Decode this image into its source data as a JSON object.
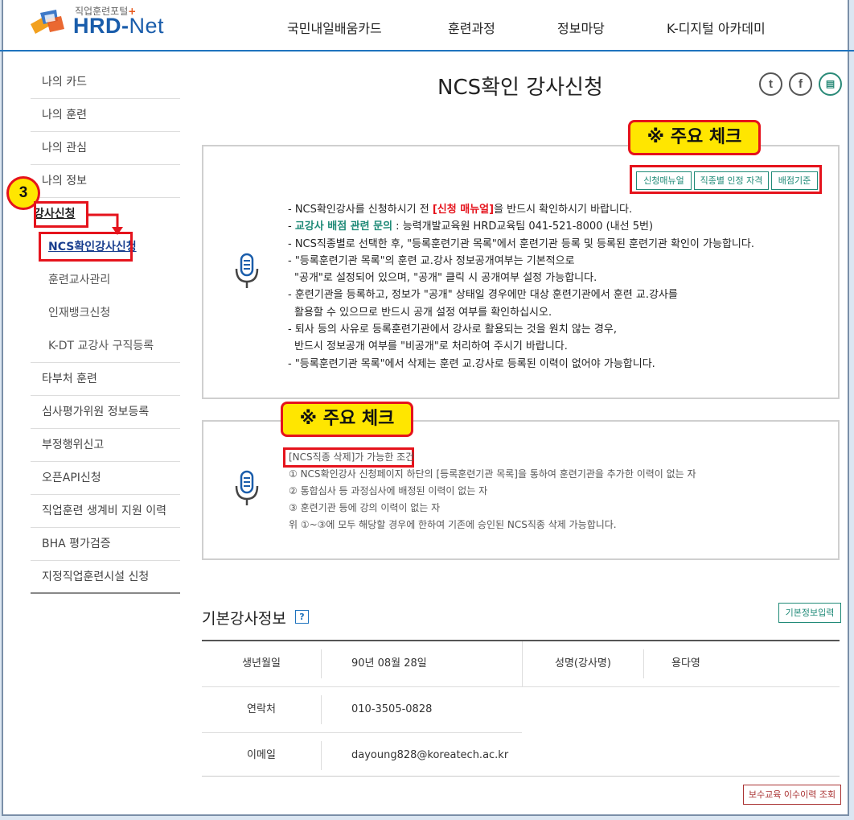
{
  "header": {
    "logo_sub": "직업훈련포털",
    "logo_plus": "+",
    "logo_main": "HRD-",
    "logo_net": "Net",
    "nav": [
      "국민내일배움카드",
      "훈련과정",
      "정보마당",
      "K-디지털 아카데미"
    ]
  },
  "sidebar": {
    "items_top": [
      "나의 카드",
      "나의 훈련",
      "나의 관심",
      "나의 정보"
    ],
    "active_parent": "강사신청",
    "active_child": "NCS확인강사신청",
    "subs": [
      "훈련교사관리",
      "인재뱅크신청",
      "K-DT 교강사 구직등록"
    ],
    "items_bottom": [
      "타부처 훈련",
      "심사평가위원 정보등록",
      "부정행위신고",
      "오픈API신청",
      "직업훈련 생계비 지원 이력",
      "BHA 평가검증",
      "지정직업훈련시설 신청"
    ],
    "step_badge": "3"
  },
  "page": {
    "title": "NCS확인 강사신청",
    "sns": [
      "twitter-icon",
      "facebook-icon",
      "print-icon"
    ]
  },
  "callouts": {
    "check1": "※ 주요 체크",
    "check2": "※ 주요 체크"
  },
  "box1": {
    "buttons": [
      "신청매뉴얼",
      "직종별 인정 자격",
      "배점기준"
    ],
    "line1_a": "- NCS확인강사를 신청하시기 전 ",
    "line1_red": "[신청 매뉴얼]",
    "line1_b": "을 반드시 확인하시기 바랍니다.",
    "line2_dash": "- ",
    "line2_teal": "교강사 배점 관련 문의",
    "line2_b": " : 능력개발교육원 HRD교육팀 041-521-8000 (내선 5번)",
    "lines": [
      "- NCS직종별로 선택한 후, \"등록훈련기관 목록\"에서 훈련기관 등록 및 등록된 훈련기관 확인이 가능합니다.",
      "- \"등록훈련기관 목록\"의 훈련 교.강사 정보공개여부는 기본적으로",
      "  \"공개\"로 설정되어 있으며, \"공개\" 클릭 시 공개여부 설정 가능합니다.",
      "- 훈련기관을 등록하고, 정보가 \"공개\" 상태일 경우에만 대상 훈련기관에서 훈련 교.강사를",
      "  활용할 수 있으므로 반드시 공개 설정 여부를 확인하십시오.",
      "- 퇴사 등의 사유로 등록훈련기관에서 강사로 활용되는 것을 원치 않는 경우,",
      "  반드시 정보공개 여부를 \"비공개\"로 처리하여 주시기 바랍니다.",
      "- \"등록훈련기관 목록\"에서 삭제는 훈련 교.강사로 등록된 이력이 없어야 가능합니다."
    ]
  },
  "box2": {
    "heading": "[NCS직종 삭제]가 가능한 조건",
    "lines": [
      "① NCS확인강사 신청페이지 하단의 [등록훈련기관 목록]을 통하여 훈련기관을 추가한 이력이 없는 자",
      "② 통합심사 등 과정심사에 배정된 이력이 없는 자",
      "③ 훈련기관 등에 강의 이력이 없는 자",
      "위 ①~③에 모두 해당할 경우에 한하여 기존에 승인된 NCS직종 삭제 가능합니다."
    ]
  },
  "basic_info": {
    "title": "기본강사정보",
    "help": "?",
    "input_button": "기본정보입력",
    "birth_label": "생년월일",
    "birth_value": "90년 08월 28일",
    "name_label": "성명(강사명)",
    "name_value": "용다영",
    "phone_label": "연락처",
    "phone_value": "010-3505-0828",
    "email_label": "이메일",
    "email_value": "dayoung828@koreatech.ac.kr",
    "history_button": "보수교육 이수이력 조회"
  },
  "colors": {
    "brand": "#1e73be",
    "accent_red": "#e5131c",
    "highlight": "#ffe600",
    "teal": "#1f8a77"
  }
}
